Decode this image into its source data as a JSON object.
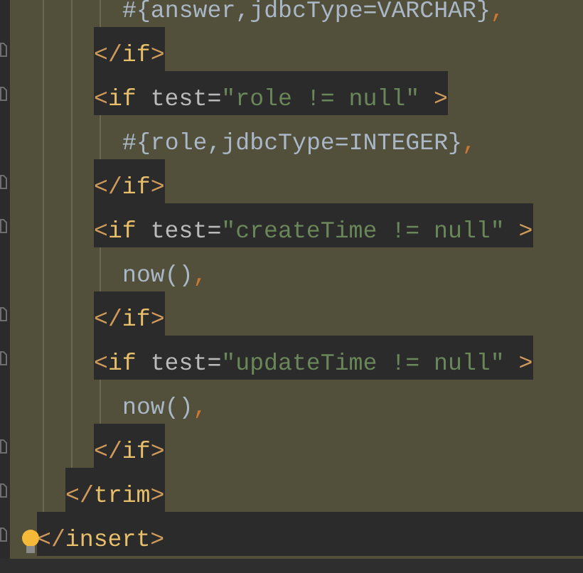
{
  "editor": {
    "lines": [
      {
        "children": [
          {
            "children": [
              {
                "children": [
                  {
                    "tokens": [
                      {
                        "text": "#{answer,jdbcType=VARCHAR}",
                        "kind": "text"
                      },
                      {
                        "text": ",",
                        "kind": "comma"
                      }
                    ],
                    "highlighted": false
                  }
                ]
              },
              {
                "tokens": [
                  {
                    "text": "</",
                    "kind": "bracket"
                  },
                  {
                    "text": "if",
                    "kind": "tag"
                  },
                  {
                    "text": ">",
                    "kind": "bracket"
                  }
                ],
                "highlighted": true
              },
              {
                "tokens": [
                  {
                    "text": "<",
                    "kind": "bracket"
                  },
                  {
                    "text": "if",
                    "kind": "tag"
                  },
                  {
                    "text": " test",
                    "kind": "attr"
                  },
                  {
                    "text": "=",
                    "kind": "attr"
                  },
                  {
                    "text": "\"role != null\"",
                    "kind": "string"
                  },
                  {
                    "text": " >",
                    "kind": "bracket"
                  }
                ],
                "highlighted": true,
                "children": [
                  {
                    "tokens": [
                      {
                        "text": "#{role,jdbcType=INTEGER}",
                        "kind": "text"
                      },
                      {
                        "text": ",",
                        "kind": "comma"
                      }
                    ],
                    "highlighted": false
                  }
                ]
              },
              {
                "tokens": [
                  {
                    "text": "</",
                    "kind": "bracket"
                  },
                  {
                    "text": "if",
                    "kind": "tag"
                  },
                  {
                    "text": ">",
                    "kind": "bracket"
                  }
                ],
                "highlighted": true
              },
              {
                "tokens": [
                  {
                    "text": "<",
                    "kind": "bracket"
                  },
                  {
                    "text": "if",
                    "kind": "tag"
                  },
                  {
                    "text": " test",
                    "kind": "attr"
                  },
                  {
                    "text": "=",
                    "kind": "attr"
                  },
                  {
                    "text": "\"createTime != null\"",
                    "kind": "string"
                  },
                  {
                    "text": " >",
                    "kind": "bracket"
                  }
                ],
                "highlighted": true,
                "children": [
                  {
                    "tokens": [
                      {
                        "text": "now()",
                        "kind": "text"
                      },
                      {
                        "text": ",",
                        "kind": "comma"
                      }
                    ],
                    "highlighted": false
                  }
                ]
              },
              {
                "tokens": [
                  {
                    "text": "</",
                    "kind": "bracket"
                  },
                  {
                    "text": "if",
                    "kind": "tag"
                  },
                  {
                    "text": ">",
                    "kind": "bracket"
                  }
                ],
                "highlighted": true
              },
              {
                "tokens": [
                  {
                    "text": "<",
                    "kind": "bracket"
                  },
                  {
                    "text": "if",
                    "kind": "tag"
                  },
                  {
                    "text": " test",
                    "kind": "attr"
                  },
                  {
                    "text": "=",
                    "kind": "attr"
                  },
                  {
                    "text": "\"updateTime != null\"",
                    "kind": "string"
                  },
                  {
                    "text": " >",
                    "kind": "bracket"
                  }
                ],
                "highlighted": true,
                "children": [
                  {
                    "tokens": [
                      {
                        "text": "now()",
                        "kind": "text"
                      },
                      {
                        "text": ",",
                        "kind": "comma"
                      }
                    ],
                    "highlighted": false
                  }
                ]
              },
              {
                "tokens": [
                  {
                    "text": "</",
                    "kind": "bracket"
                  },
                  {
                    "text": "if",
                    "kind": "tag"
                  },
                  {
                    "text": ">",
                    "kind": "bracket"
                  }
                ],
                "highlighted": true
              }
            ]
          },
          {
            "tokens": [
              {
                "text": "</",
                "kind": "bracket"
              },
              {
                "text": "trim",
                "kind": "tag"
              },
              {
                "text": ">",
                "kind": "bracket"
              }
            ],
            "highlighted": true
          }
        ]
      },
      {
        "tokens": [
          {
            "text": "</",
            "kind": "bracket"
          },
          {
            "text": "insert",
            "kind": "tag"
          },
          {
            "text": ">",
            "kind": "bracket"
          }
        ],
        "highlighted": true,
        "current": true
      }
    ]
  }
}
